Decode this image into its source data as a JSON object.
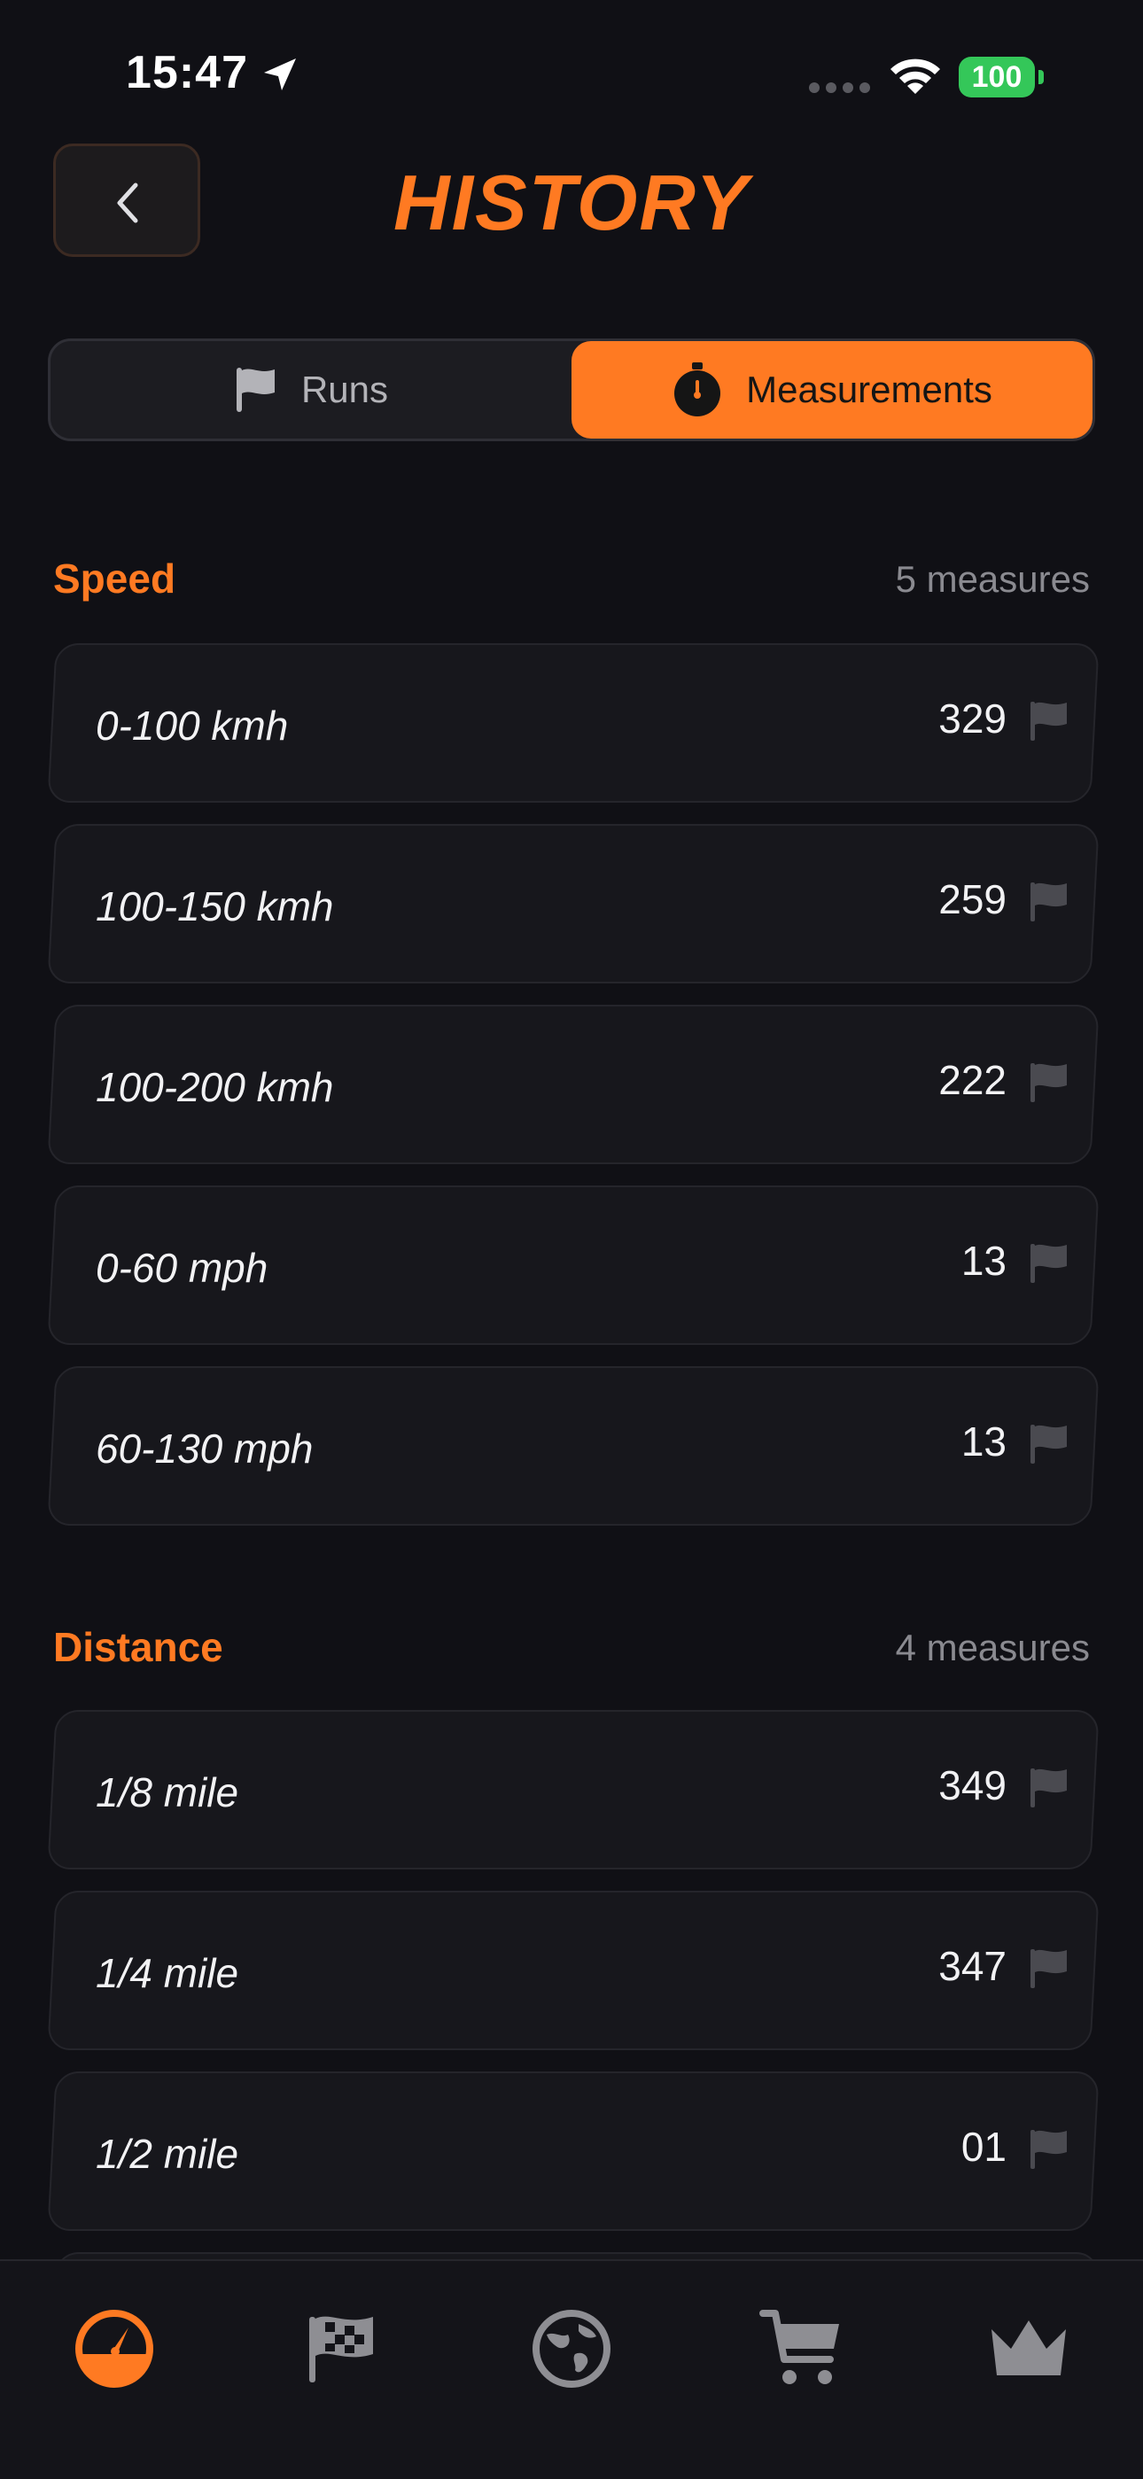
{
  "status_bar": {
    "time": "15:47",
    "battery": "100"
  },
  "header": {
    "title": "HISTORY"
  },
  "segment": {
    "tabs": [
      {
        "label": "Runs",
        "icon": "flag-icon",
        "active": false
      },
      {
        "label": "Measurements",
        "icon": "stopwatch-icon",
        "active": true
      }
    ]
  },
  "sections": [
    {
      "title": "Speed",
      "count": "5 measures",
      "items": [
        {
          "label": "0-100 kmh",
          "value": "329"
        },
        {
          "label": "100-150 kmh",
          "value": "259"
        },
        {
          "label": "100-200 kmh",
          "value": "222"
        },
        {
          "label": "0-60 mph",
          "value": "13"
        },
        {
          "label": "60-130 mph",
          "value": "13"
        }
      ]
    },
    {
      "title": "Distance",
      "count": "4 measures",
      "items": [
        {
          "label": "1/8 mile",
          "value": "349"
        },
        {
          "label": "1/4 mile",
          "value": "347"
        },
        {
          "label": "1/2 mile",
          "value": "01"
        }
      ]
    }
  ],
  "tab_bar": {
    "items": [
      {
        "icon": "speedometer-icon",
        "active": true
      },
      {
        "icon": "checkered-flag-icon",
        "active": false
      },
      {
        "icon": "globe-icon",
        "active": false
      },
      {
        "icon": "cart-icon",
        "active": false
      },
      {
        "icon": "crown-icon",
        "active": false
      }
    ]
  },
  "colors": {
    "accent": "#ff7a22",
    "background": "#101015",
    "row_background": "#17171c",
    "inactive_icon": "#8e8e93",
    "battery": "#34c759"
  }
}
